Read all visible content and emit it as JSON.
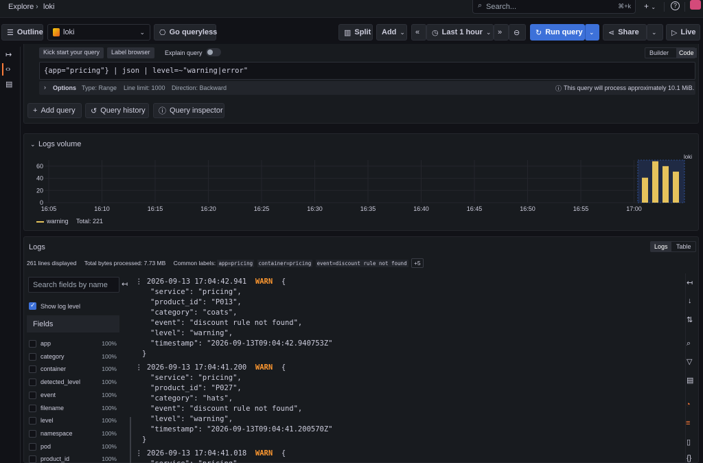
{
  "topbar": {
    "breadcrumb": [
      "Explore",
      "loki"
    ],
    "search_placeholder": "Search...",
    "search_shortcut": "⌘+k",
    "icons": [
      "plus-icon",
      "help-icon",
      "avatar"
    ]
  },
  "toolbar": {
    "outline_label": "Outline",
    "datasource": "loki",
    "go_queryless_label": "Go queryless",
    "split_label": "Split",
    "add_label": "Add",
    "time_range": "Last 1 hour",
    "run_query_label": "Run query",
    "share_label": "Share",
    "live_label": "Live"
  },
  "query": {
    "kickstart_label": "Kick start your query",
    "label_browser_label": "Label browser",
    "explain_label": "Explain query",
    "builder_label": "Builder",
    "code_label": "Code",
    "expr": "{app=\"pricing\"} | json | level=~\"warning|error\"",
    "options_label": "Options",
    "options_type": "Type: Range",
    "options_line_limit": "Line limit: 1000",
    "options_direction": "Direction: Backward",
    "estimate_text": "This query will process approximately 10.1 MiB.",
    "add_query_label": "Add query",
    "query_history_label": "Query history",
    "query_inspector_label": "Query inspector"
  },
  "volume": {
    "title": "Logs volume",
    "datasource_tag": "loki",
    "legend_series": "warning",
    "legend_total": "Total: 221"
  },
  "chart_data": {
    "type": "bar",
    "title": "Logs volume",
    "xlabel": "",
    "ylabel": "",
    "ylim": [
      0,
      70
    ],
    "y_ticks": [
      "0",
      "20",
      "40",
      "60"
    ],
    "x_ticks": [
      "16:05",
      "16:10",
      "16:15",
      "16:20",
      "16:25",
      "16:30",
      "16:35",
      "16:40",
      "16:45",
      "16:50",
      "16:55",
      "17:00"
    ],
    "categories": [
      "17:01",
      "17:02",
      "17:03",
      "17:04"
    ],
    "series": [
      {
        "name": "warning",
        "values": [
          41,
          68,
          60,
          51
        ],
        "color": "#e6c35c"
      }
    ],
    "grid": true,
    "legend": "bottom-left"
  },
  "logs": {
    "title": "Logs",
    "view_logs": "Logs",
    "view_table": "Table",
    "lines_displayed": "261 lines displayed",
    "bytes_processed": "Total bytes processed: 7.73 MB",
    "common_labels_label": "Common labels:",
    "common_labels": [
      "app=pricing",
      "container=pricing",
      "event=discount rule not found"
    ],
    "more_labels": "+5",
    "field_search_placeholder": "Search fields by name",
    "show_log_level_label": "Show log level",
    "fields_title": "Fields",
    "fields": [
      {
        "name": "app",
        "pct": "100%"
      },
      {
        "name": "category",
        "pct": "100%"
      },
      {
        "name": "container",
        "pct": "100%"
      },
      {
        "name": "detected_level",
        "pct": "100%"
      },
      {
        "name": "event",
        "pct": "100%"
      },
      {
        "name": "filename",
        "pct": "100%"
      },
      {
        "name": "level",
        "pct": "100%"
      },
      {
        "name": "namespace",
        "pct": "100%"
      },
      {
        "name": "pod",
        "pct": "100%"
      },
      {
        "name": "product_id",
        "pct": "100%"
      }
    ],
    "lines": [
      {
        "ts": "2026-09-13 17:04:42.941",
        "level": "WARN",
        "body": [
          "\"service\": \"pricing\",",
          "\"product_id\": \"P013\",",
          "\"category\": \"coats\",",
          "\"event\": \"discount rule not found\",",
          "\"level\": \"warning\",",
          "\"timestamp\": \"2026-09-13T09:04:42.940753Z\""
        ]
      },
      {
        "ts": "2026-09-13 17:04:41.200",
        "level": "WARN",
        "body": [
          "\"service\": \"pricing\",",
          "\"product_id\": \"P027\",",
          "\"category\": \"hats\",",
          "\"event\": \"discount rule not found\",",
          "\"level\": \"warning\",",
          "\"timestamp\": \"2026-09-13T09:04:41.200570Z\""
        ]
      },
      {
        "ts": "2026-09-13 17:04:41.018",
        "level": "WARN",
        "body": [
          "\"service\": \"pricing\","
        ]
      }
    ]
  }
}
